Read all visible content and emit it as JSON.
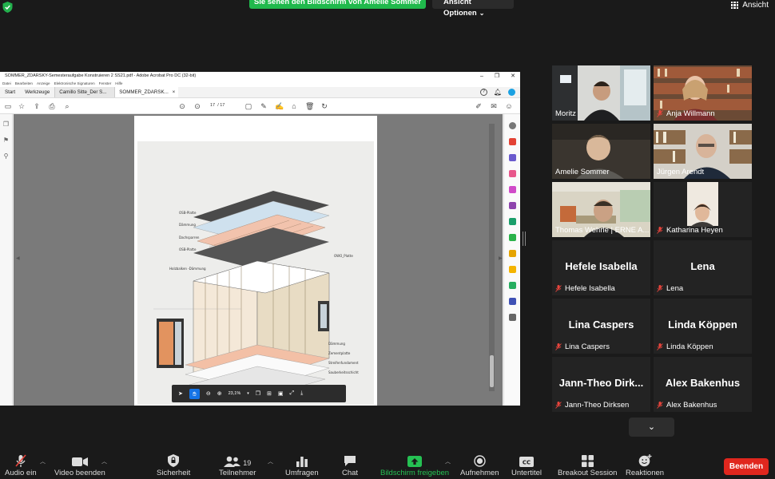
{
  "top": {
    "share_banner": "Sie sehen den Bildschirm von Amelie Sommer",
    "view_options": "Ansicht Optionen",
    "view_button": "Ansicht"
  },
  "acrobat": {
    "title": "SOMMER_ZDARSKY-Semesteraufgabe Konstruieren 2 SS21.pdf - Adobe Acrobat Pro DC (32-bit)",
    "menu": [
      "Datei",
      "Bearbeiten",
      "Anzeige",
      "Elektronische Signaturen",
      "Fenster",
      "Hilfe"
    ],
    "tabs": {
      "start": "Start",
      "tools": "Werkzeuge",
      "doc1": "Camillo Sitte_Der S...",
      "doc2": "SOMMER_ZDARSK..."
    },
    "page_current": "17",
    "page_total": "/ 17",
    "zoom": "23,1%",
    "drawing_labels": {
      "osb_top": "OSB-Platte",
      "daemmung_top": "Dämmung",
      "dachsparren": "Dachsparren",
      "osb_mid": "OSB-Platte",
      "holzbalken": "Holzbalken -Dämmung",
      "osb_right": "OWO_Platte",
      "daemmung_bottom": "Dämmung",
      "zementplatte": "Zementplatte",
      "streifen": "Streifenfundament",
      "sauber": "Sauberkeitsschicht",
      "fussboden": "Fußbodenaufbau"
    }
  },
  "participants": [
    {
      "name": "Moritz",
      "muted": false,
      "video": true
    },
    {
      "name": "Anja Willmann",
      "muted": true,
      "video": true
    },
    {
      "name": "Amelie Sommer",
      "muted": false,
      "video": true
    },
    {
      "name": "Jürgen Arendt",
      "muted": false,
      "video": true
    },
    {
      "name": "Thomas Wehrle | ERNE A...",
      "muted": false,
      "video": true,
      "speaker": true
    },
    {
      "name": "Katharina Heyen",
      "muted": true,
      "video": true
    },
    {
      "name": "Hefele Isabella",
      "display": "Hefele Isabella",
      "muted": true,
      "video": false
    },
    {
      "name": "Lena",
      "display": "Lena",
      "muted": true,
      "video": false
    },
    {
      "name": "Lina Caspers",
      "display": "Lina Caspers",
      "muted": true,
      "video": false
    },
    {
      "name": "Linda Köppen",
      "display": "Linda Köppen",
      "muted": true,
      "video": false
    },
    {
      "name": "Jann-Theo Dirksen",
      "display": "Jann-Theo Dirk...",
      "muted": true,
      "video": false
    },
    {
      "name": "Alex Bakenhus",
      "display": "Alex Bakenhus",
      "muted": true,
      "video": false
    }
  ],
  "toolbar": {
    "audio": "Audio ein",
    "video": "Video beenden",
    "security": "Sicherheit",
    "participants": "Teilnehmer",
    "participant_count": "19",
    "polls": "Umfragen",
    "chat": "Chat",
    "share": "Bildschirm freigeben",
    "record": "Aufnehmen",
    "captions": "Untertitel",
    "breakout": "Breakout Session",
    "reactions": "Reaktionen",
    "end": "Beenden"
  },
  "colors": {
    "share_green": "#20b94c",
    "end_red": "#e0271e",
    "speaker_outline": "#d6ef3a",
    "acrobat_blue": "#1473e6"
  }
}
